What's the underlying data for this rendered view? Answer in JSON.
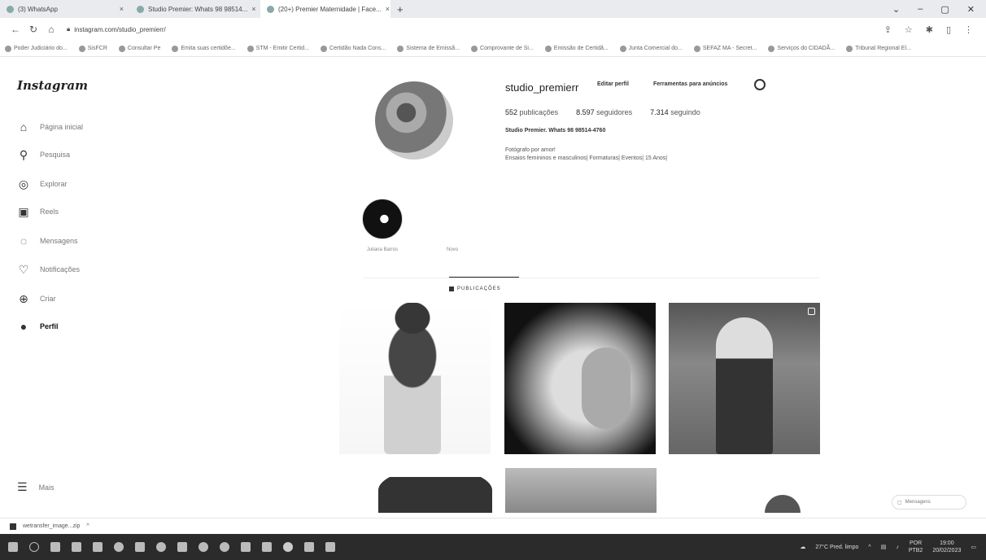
{
  "browser": {
    "tabs": [
      {
        "label": "(3) WhatsApp"
      },
      {
        "label": "Studio Premier: Whats 98 98514..."
      },
      {
        "label": "(20+) Premier Maternidade | Face..."
      }
    ],
    "new_tab": "+",
    "url": "instagram.com/studio_premierr/",
    "bookmarks": [
      "Poder Judiciário do...",
      "SisFCR",
      "Consultar Pe",
      "Emita suas certidõe...",
      "STM - Emitir Certid...",
      "Certidão Nada Cons...",
      "Sistema de Emissã...",
      "Comprovante de Si...",
      "Emissão de Certidã...",
      "Junta Comercial do...",
      "SEFAZ MA - Secret...",
      "Serviços do CIDADÃ...",
      "Tribunal Regional El..."
    ]
  },
  "sidebar": {
    "logo": "Instagram",
    "items": [
      {
        "label": "Página inicial"
      },
      {
        "label": "Pesquisa"
      },
      {
        "label": "Explorar"
      },
      {
        "label": "Reels"
      },
      {
        "label": "Mensagens"
      },
      {
        "label": "Notificações"
      },
      {
        "label": "Criar"
      },
      {
        "label": "Perfil"
      }
    ],
    "more": "Mais"
  },
  "profile": {
    "username": "studio_premierr",
    "edit_label": "Editar perfil",
    "ads_label": "Ferramentas para anúncios",
    "stats": {
      "posts_num": "552",
      "posts_label": "publicações",
      "followers_num": "8.597",
      "followers_label": "seguidores",
      "following_num": "7.314",
      "following_label": "seguindo"
    },
    "fullname": "Studio Premier. Whats 98 98514-4760",
    "bio_line1": "Fotógrafo por amor!",
    "bio_line2": "Ensaios femininos e masculinos| Formaturas| Eventos| 15 Anos|"
  },
  "highlights": [
    {
      "label": "Juliana Barros"
    },
    {
      "label": "Novo"
    }
  ],
  "tabs": {
    "posts": "PUBLICAÇÕES"
  },
  "messages_pill": "Mensagens",
  "download": {
    "file": "wetransfer_image...zip"
  },
  "taskbar": {
    "weather": "27°C Pred. limpo",
    "lang1": "POR",
    "lang2": "PTB2",
    "time": "19:00",
    "date": "20/02/2023"
  }
}
